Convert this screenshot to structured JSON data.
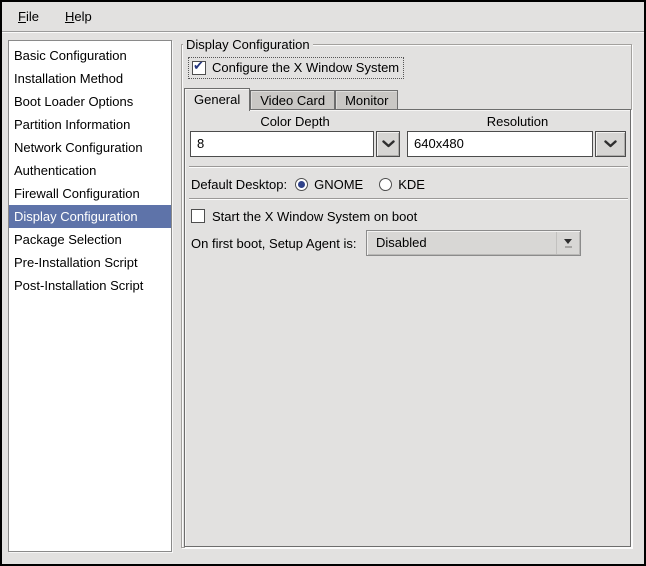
{
  "menubar": {
    "items": [
      {
        "label": "File"
      },
      {
        "label": "Help"
      }
    ]
  },
  "sidebar": {
    "items": [
      "Basic Configuration",
      "Installation Method",
      "Boot Loader Options",
      "Partition Information",
      "Network Configuration",
      "Authentication",
      "Firewall Configuration",
      "Display Configuration",
      "Package Selection",
      "Pre-Installation Script",
      "Post-Installation Script"
    ],
    "selected": "Display Configuration"
  },
  "main": {
    "frame_title": "Display Configuration",
    "configure_x": {
      "label": "Configure the X Window System",
      "checked": true
    },
    "tabs": {
      "items": [
        "General",
        "Video Card",
        "Monitor"
      ],
      "active": "General"
    },
    "general": {
      "color_depth": {
        "label": "Color Depth",
        "value": "8"
      },
      "resolution": {
        "label": "Resolution",
        "value": "640x480"
      },
      "default_desktop": {
        "label": "Default Desktop:",
        "options": [
          "GNOME",
          "KDE"
        ],
        "selected": "GNOME"
      },
      "start_x": {
        "label": "Start the X Window System on boot",
        "checked": false
      },
      "setup_agent": {
        "label": "On first boot, Setup Agent is:",
        "value": "Disabled"
      }
    }
  },
  "icons": {
    "checkmark": "✔"
  },
  "colors": {
    "selection_bg": "#5e73a9",
    "selection_text": "#ffffff",
    "check_blue": "#24367e",
    "panel_bg": "#e2e1e0",
    "inactive_tab_bg": "#c9c7c4"
  }
}
